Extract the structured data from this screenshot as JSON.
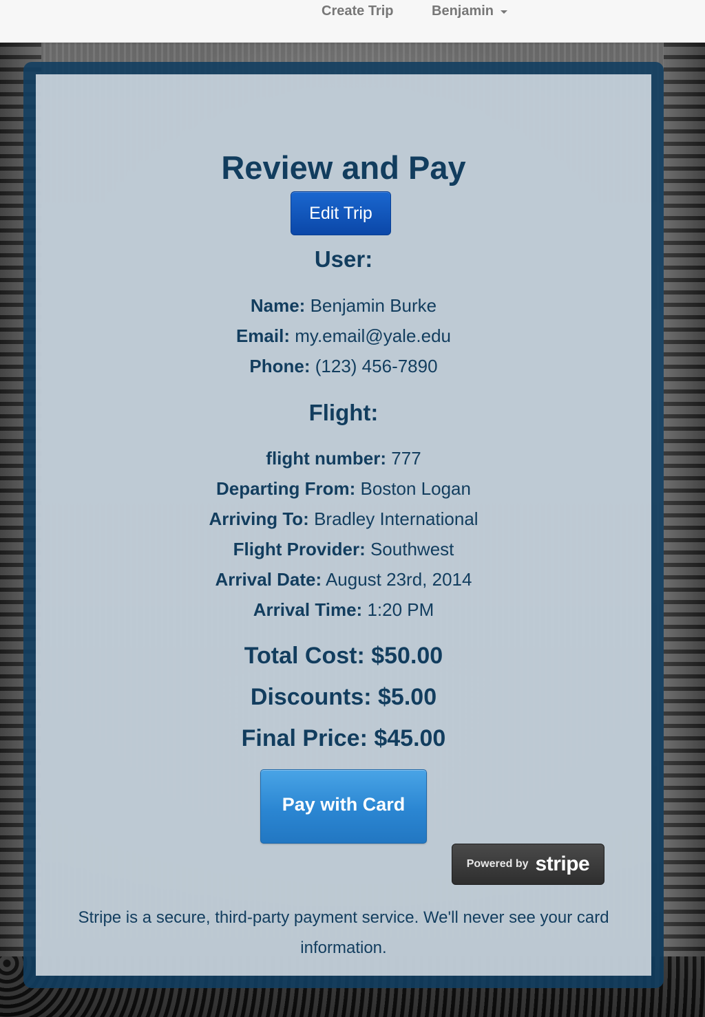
{
  "nav": {
    "create_trip": "Create Trip",
    "user_menu": "Benjamin",
    "user_menu_icon": "caret-down-icon"
  },
  "page": {
    "title": "Review and Pay",
    "edit_button": "Edit Trip"
  },
  "user_section": {
    "heading": "User:",
    "fields": [
      {
        "label": "Name:",
        "value": "Benjamin Burke"
      },
      {
        "label": "Email:",
        "value": "my.email@yale.edu"
      },
      {
        "label": "Phone:",
        "value": "(123) 456-7890"
      }
    ]
  },
  "flight_section": {
    "heading": "Flight:",
    "fields": [
      {
        "label": "flight number:",
        "value": "777"
      },
      {
        "label": "Departing From:",
        "value": "Boston Logan"
      },
      {
        "label": "Arriving To:",
        "value": "Bradley International"
      },
      {
        "label": "Flight Provider:",
        "value": "Southwest"
      },
      {
        "label": "Arrival Date:",
        "value": "August 23rd, 2014"
      },
      {
        "label": "Arrival Time:",
        "value": "1:20 PM"
      }
    ]
  },
  "pricing": {
    "total": "Total Cost: $50.00",
    "discounts": "Discounts: $5.00",
    "final": "Final Price: $45.00"
  },
  "payment": {
    "pay_button": "Pay with Card",
    "stripe_powered": "Powered by",
    "stripe_name": "stripe",
    "disclaimer": "Stripe is a secure, third-party payment service. We'll never see your card information."
  },
  "colors": {
    "panel_border": "#123e60",
    "heading_text": "#123d5e",
    "edit_button": "#1a5fc6",
    "pay_button": "#2b86d2",
    "stripe_badge": "#333333",
    "navbar_bg": "#f7f7f7"
  }
}
